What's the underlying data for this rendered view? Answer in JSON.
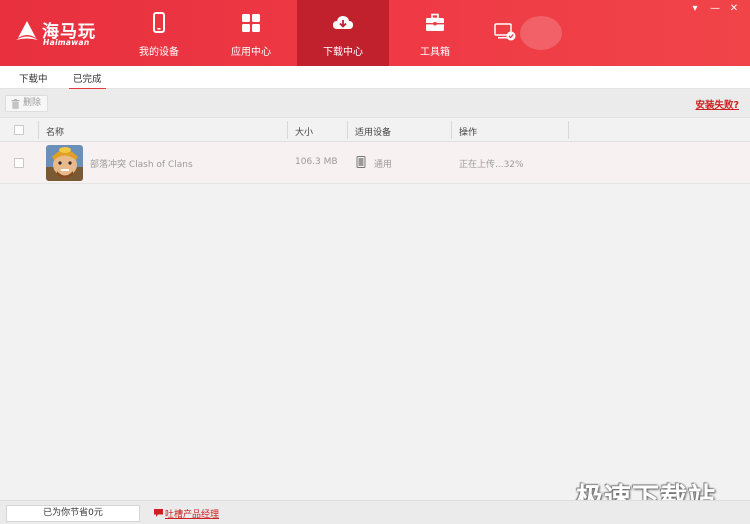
{
  "app": {
    "logo_text": "海马玩",
    "logo_sub": "Haimawan"
  },
  "nav": [
    {
      "label": "我的设备",
      "icon": "phone-icon"
    },
    {
      "label": "应用中心",
      "icon": "grid-icon"
    },
    {
      "label": "下载中心",
      "icon": "cloud-download-icon",
      "active": true
    },
    {
      "label": "工具箱",
      "icon": "toolbox-icon"
    }
  ],
  "window_controls": {
    "dropdown": "▾",
    "minimize": "—",
    "close": "✕"
  },
  "tabs": [
    {
      "label": "下载中",
      "active": false
    },
    {
      "label": "已完成",
      "active": true
    }
  ],
  "toolbar": {
    "delete_label": "删除",
    "install_fail_label": "安装失败?"
  },
  "table": {
    "headers": {
      "name": "名称",
      "size": "大小",
      "device": "适用设备",
      "action": "操作"
    },
    "rows": [
      {
        "name": "部落冲突 Clash of Clans",
        "size": "106.3 MB",
        "device": "通用",
        "status": "正在上传...32%",
        "progress": 0.32
      }
    ]
  },
  "footer": {
    "saved_text": "已为你节省0元",
    "feedback_text": "吐槽产品经理"
  },
  "watermark": "极速下载站",
  "colors": {
    "header_red": "#ef3a45",
    "active_nav": "#c1202d",
    "link_red": "#cc1f1f"
  }
}
